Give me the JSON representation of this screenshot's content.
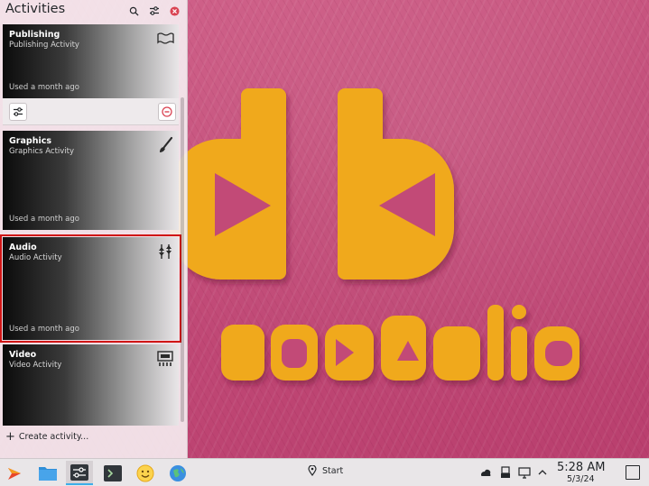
{
  "panel": {
    "title": "Activities",
    "create_label": "Create activity..."
  },
  "activities": [
    {
      "name": "Publishing",
      "description": "Publishing Activity",
      "last_used": "Used a month ago",
      "icon": "publishing-icon"
    },
    {
      "name": "Graphics",
      "description": "Graphics Activity",
      "last_used": "Used a month ago",
      "icon": "paintbrush-icon"
    },
    {
      "name": "Audio",
      "description": "Audio Activity",
      "last_used": "Used a month ago",
      "icon": "audio-mixer-icon"
    },
    {
      "name": "Video",
      "description": "Video Activity",
      "last_used": "",
      "icon": "video-editor-icon"
    }
  ],
  "taskbar": {
    "start_label": "Start",
    "clock_time": "5:28 AM",
    "clock_date": "5/3/24",
    "apps": [
      "app-launcher-icon",
      "file-manager-icon",
      "activities-switcher-icon",
      "terminal-icon",
      "emoji-icon",
      "browser-icon"
    ],
    "tray": [
      "network-icon",
      "usb-icon",
      "display-icon",
      "chevron-up-icon"
    ]
  },
  "colors": {
    "selection_outline": "#d01515",
    "wallpaper": "#c44f7a",
    "logo": "#f0a91c",
    "accent": "#3daee9"
  }
}
